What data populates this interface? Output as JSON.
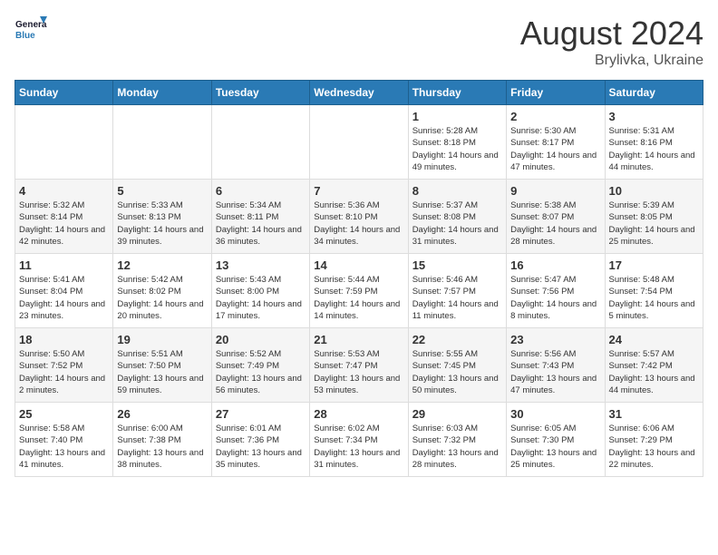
{
  "logo": {
    "line1": "General",
    "line2": "Blue"
  },
  "title": "August 2024",
  "subtitle": "Brylivka, Ukraine",
  "days_of_week": [
    "Sunday",
    "Monday",
    "Tuesday",
    "Wednesday",
    "Thursday",
    "Friday",
    "Saturday"
  ],
  "weeks": [
    [
      {
        "day": "",
        "sunrise": "",
        "sunset": "",
        "daylight": ""
      },
      {
        "day": "",
        "sunrise": "",
        "sunset": "",
        "daylight": ""
      },
      {
        "day": "",
        "sunrise": "",
        "sunset": "",
        "daylight": ""
      },
      {
        "day": "",
        "sunrise": "",
        "sunset": "",
        "daylight": ""
      },
      {
        "day": "1",
        "sunrise": "5:28 AM",
        "sunset": "8:18 PM",
        "daylight": "14 hours and 49 minutes."
      },
      {
        "day": "2",
        "sunrise": "5:30 AM",
        "sunset": "8:17 PM",
        "daylight": "14 hours and 47 minutes."
      },
      {
        "day": "3",
        "sunrise": "5:31 AM",
        "sunset": "8:16 PM",
        "daylight": "14 hours and 44 minutes."
      }
    ],
    [
      {
        "day": "4",
        "sunrise": "5:32 AM",
        "sunset": "8:14 PM",
        "daylight": "14 hours and 42 minutes."
      },
      {
        "day": "5",
        "sunrise": "5:33 AM",
        "sunset": "8:13 PM",
        "daylight": "14 hours and 39 minutes."
      },
      {
        "day": "6",
        "sunrise": "5:34 AM",
        "sunset": "8:11 PM",
        "daylight": "14 hours and 36 minutes."
      },
      {
        "day": "7",
        "sunrise": "5:36 AM",
        "sunset": "8:10 PM",
        "daylight": "14 hours and 34 minutes."
      },
      {
        "day": "8",
        "sunrise": "5:37 AM",
        "sunset": "8:08 PM",
        "daylight": "14 hours and 31 minutes."
      },
      {
        "day": "9",
        "sunrise": "5:38 AM",
        "sunset": "8:07 PM",
        "daylight": "14 hours and 28 minutes."
      },
      {
        "day": "10",
        "sunrise": "5:39 AM",
        "sunset": "8:05 PM",
        "daylight": "14 hours and 25 minutes."
      }
    ],
    [
      {
        "day": "11",
        "sunrise": "5:41 AM",
        "sunset": "8:04 PM",
        "daylight": "14 hours and 23 minutes."
      },
      {
        "day": "12",
        "sunrise": "5:42 AM",
        "sunset": "8:02 PM",
        "daylight": "14 hours and 20 minutes."
      },
      {
        "day": "13",
        "sunrise": "5:43 AM",
        "sunset": "8:00 PM",
        "daylight": "14 hours and 17 minutes."
      },
      {
        "day": "14",
        "sunrise": "5:44 AM",
        "sunset": "7:59 PM",
        "daylight": "14 hours and 14 minutes."
      },
      {
        "day": "15",
        "sunrise": "5:46 AM",
        "sunset": "7:57 PM",
        "daylight": "14 hours and 11 minutes."
      },
      {
        "day": "16",
        "sunrise": "5:47 AM",
        "sunset": "7:56 PM",
        "daylight": "14 hours and 8 minutes."
      },
      {
        "day": "17",
        "sunrise": "5:48 AM",
        "sunset": "7:54 PM",
        "daylight": "14 hours and 5 minutes."
      }
    ],
    [
      {
        "day": "18",
        "sunrise": "5:50 AM",
        "sunset": "7:52 PM",
        "daylight": "14 hours and 2 minutes."
      },
      {
        "day": "19",
        "sunrise": "5:51 AM",
        "sunset": "7:50 PM",
        "daylight": "13 hours and 59 minutes."
      },
      {
        "day": "20",
        "sunrise": "5:52 AM",
        "sunset": "7:49 PM",
        "daylight": "13 hours and 56 minutes."
      },
      {
        "day": "21",
        "sunrise": "5:53 AM",
        "sunset": "7:47 PM",
        "daylight": "13 hours and 53 minutes."
      },
      {
        "day": "22",
        "sunrise": "5:55 AM",
        "sunset": "7:45 PM",
        "daylight": "13 hours and 50 minutes."
      },
      {
        "day": "23",
        "sunrise": "5:56 AM",
        "sunset": "7:43 PM",
        "daylight": "13 hours and 47 minutes."
      },
      {
        "day": "24",
        "sunrise": "5:57 AM",
        "sunset": "7:42 PM",
        "daylight": "13 hours and 44 minutes."
      }
    ],
    [
      {
        "day": "25",
        "sunrise": "5:58 AM",
        "sunset": "7:40 PM",
        "daylight": "13 hours and 41 minutes."
      },
      {
        "day": "26",
        "sunrise": "6:00 AM",
        "sunset": "7:38 PM",
        "daylight": "13 hours and 38 minutes."
      },
      {
        "day": "27",
        "sunrise": "6:01 AM",
        "sunset": "7:36 PM",
        "daylight": "13 hours and 35 minutes."
      },
      {
        "day": "28",
        "sunrise": "6:02 AM",
        "sunset": "7:34 PM",
        "daylight": "13 hours and 31 minutes."
      },
      {
        "day": "29",
        "sunrise": "6:03 AM",
        "sunset": "7:32 PM",
        "daylight": "13 hours and 28 minutes."
      },
      {
        "day": "30",
        "sunrise": "6:05 AM",
        "sunset": "7:30 PM",
        "daylight": "13 hours and 25 minutes."
      },
      {
        "day": "31",
        "sunrise": "6:06 AM",
        "sunset": "7:29 PM",
        "daylight": "13 hours and 22 minutes."
      }
    ]
  ],
  "cell_labels": {
    "sunrise": "Sunrise:",
    "sunset": "Sunset:",
    "daylight": "Daylight:"
  }
}
